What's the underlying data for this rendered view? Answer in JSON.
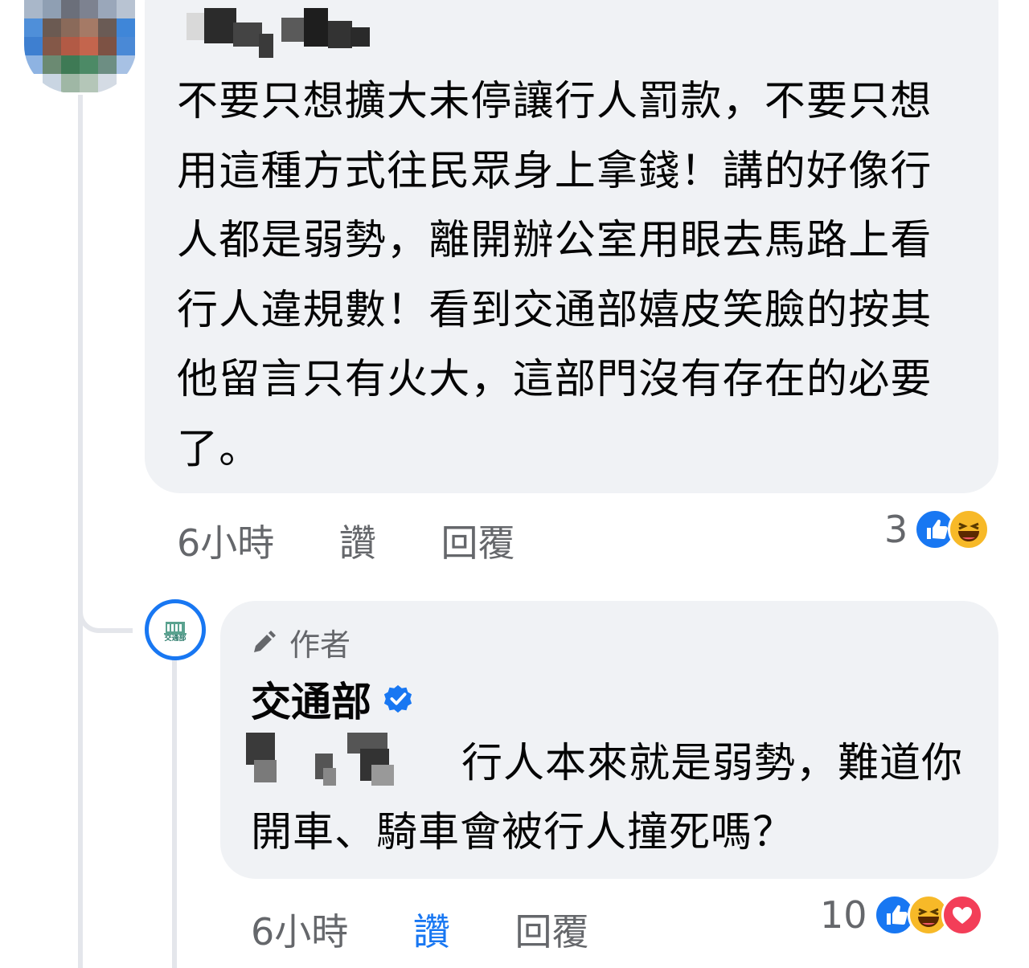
{
  "comment": {
    "text": "不要只想擴大未停讓行人罰款，不要只想用這種方式往民眾身上拿錢！講的好像行人都是弱勢，離開辦公室用眼去馬路上看行人違規數！看到交通部嬉皮笑臉的按其他留言只有火大，這部門沒有存在的必要了。",
    "time": "6小時",
    "like_label": "讚",
    "reply_label": "回覆",
    "reaction_count": "3",
    "reactions": [
      "like-icon",
      "haha-icon"
    ]
  },
  "reply": {
    "author_badge": "作者",
    "author_name": "交通部",
    "logo_text": "交通部",
    "text": "行人本來就是弱勢，難道你開車、騎車會被行人撞死嗎？",
    "time": "6小時",
    "like_label": "讚",
    "reply_label": "回覆",
    "reaction_count": "10",
    "reactions": [
      "like-icon",
      "haha-icon",
      "love-icon"
    ]
  },
  "colors": {
    "bubble": "#f0f2f5",
    "meta_text": "#65676b",
    "accent_blue": "#1877f2",
    "haha_yellow": "#f7b928",
    "love_red": "#f33e58"
  }
}
